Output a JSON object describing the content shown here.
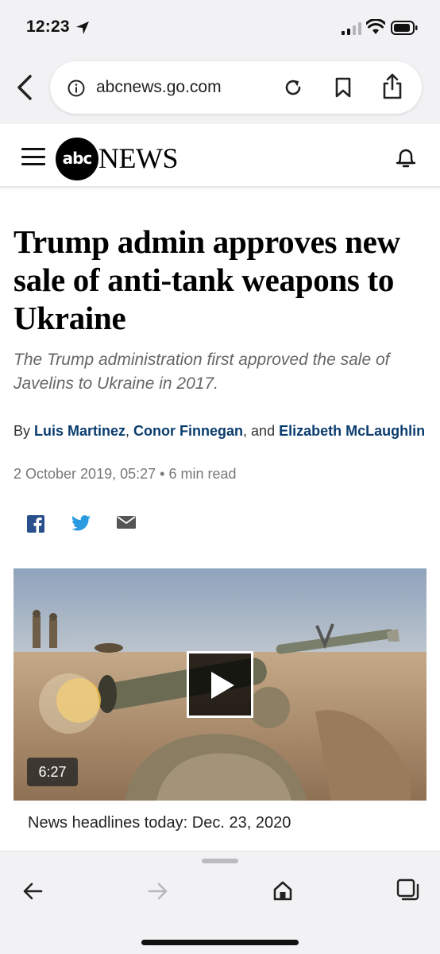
{
  "status_bar": {
    "time": "12:23"
  },
  "browser": {
    "url": "abcnews.go.com"
  },
  "header": {
    "logo_text": "abc",
    "logo_word": "NEWS"
  },
  "article": {
    "headline": "Trump admin approves new sale of anti-tank weapons to Ukraine",
    "subheadline": "The Trump administration first approved the sale of Javelins to Ukraine in 2017.",
    "byline": {
      "prefix": "By ",
      "authors": [
        "Luis Martinez",
        "Conor Finnegan",
        "Elizabeth McLaughlin"
      ],
      "sep1": ", ",
      "sep2": ", and "
    },
    "date": "2 October 2019, 05:27",
    "read_time": "6 min read",
    "date_separator": " • "
  },
  "share": {
    "icons": [
      "facebook-icon",
      "twitter-icon",
      "email-icon"
    ]
  },
  "video": {
    "duration": "6:27",
    "caption": "News headlines today: Dec. 23, 2020"
  },
  "colors": {
    "author_link": "#0a3c6e",
    "chrome_bg": "#f2f2f4"
  }
}
